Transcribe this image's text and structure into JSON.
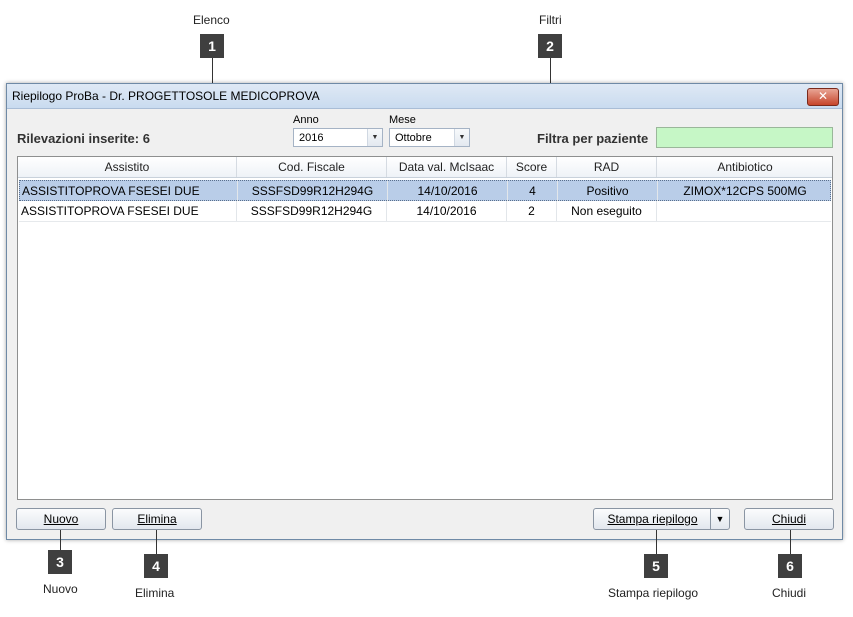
{
  "callouts": [
    {
      "num": "1",
      "label": "Elenco"
    },
    {
      "num": "2",
      "label": "Filtri"
    },
    {
      "num": "3",
      "label": "Nuovo"
    },
    {
      "num": "4",
      "label": "Elimina"
    },
    {
      "num": "5",
      "label": "Stampa riepilogo"
    },
    {
      "num": "6",
      "label": "Chiudi"
    }
  ],
  "window": {
    "title": "Riepilogo ProBa - Dr. PROGETTOSOLE MEDICOPROVA",
    "close_glyph": "✕"
  },
  "header": {
    "count_label": "Rilevazioni inserite: 6",
    "year_caption": "Anno",
    "year_value": "2016",
    "month_caption": "Mese",
    "month_value": "Ottobre",
    "filter_label": "Filtra per paziente",
    "filter_value": ""
  },
  "table": {
    "columns": [
      "Assistito",
      "Cod. Fiscale",
      "Data val. McIsaac",
      "Score",
      "RAD",
      "Antibiotico"
    ],
    "rows": [
      [
        "ASSISTITOPROVA FSESEI DUE",
        "SSSFSD99R12H294G",
        "14/10/2016",
        "4",
        "Positivo",
        "ZIMOX*12CPS 500MG"
      ],
      [
        "ASSISTITOPROVA FSESEI DUE",
        "SSSFSD99R12H294G",
        "14/10/2016",
        "2",
        "Non eseguito",
        ""
      ]
    ]
  },
  "buttons": {
    "nuovo": "Nuovo",
    "elimina": "Elimina",
    "stampa": "Stampa riepilogo",
    "chiudi": "Chiudi"
  },
  "colors": {
    "filter_bg": "#c6f7c6",
    "selected_row": "#b9cde8",
    "badge_bg": "#3f3f3f"
  }
}
